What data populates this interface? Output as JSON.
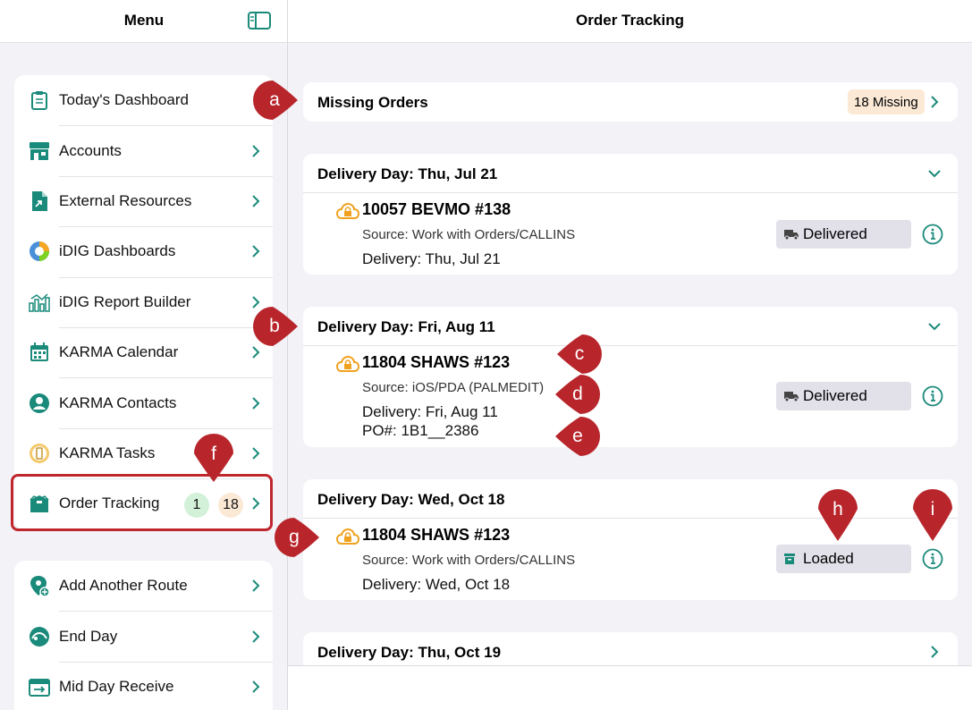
{
  "sidebar": {
    "title": "Menu",
    "groups": [
      [
        {
          "label": "Today's Dashboard",
          "icon": "clipboard-icon"
        },
        {
          "label": "Accounts",
          "icon": "store-icon"
        },
        {
          "label": "External Resources",
          "icon": "external-doc-icon"
        },
        {
          "label": "iDIG Dashboards",
          "icon": "pie-chart-icon"
        },
        {
          "label": "iDIG Report Builder",
          "icon": "bar-chart-icon"
        },
        {
          "label": "KARMA Calendar",
          "icon": "calendar-icon"
        },
        {
          "label": "KARMA Contacts",
          "icon": "person-icon"
        },
        {
          "label": "KARMA Tasks",
          "icon": "tasks-icon"
        },
        {
          "label": "Order Tracking",
          "icon": "box-icon",
          "badges": [
            "1",
            "18"
          ]
        }
      ],
      [
        {
          "label": "Add Another Route",
          "icon": "route-pin-icon"
        },
        {
          "label": "End Day",
          "icon": "end-day-icon"
        },
        {
          "label": "Mid Day Receive",
          "icon": "receive-calendar-icon"
        }
      ]
    ]
  },
  "main": {
    "title": "Order Tracking",
    "missing": {
      "label": "Missing Orders",
      "count": "18 Missing"
    },
    "days": [
      {
        "header": "Delivery Day: Thu, Jul 21",
        "expanded": true,
        "order": {
          "name": "10057 BEVMO #138",
          "source": "Source: Work with Orders/CALLINS",
          "delivery": "Delivery: Thu, Jul 21",
          "po": "",
          "status": "Delivered"
        }
      },
      {
        "header": "Delivery Day: Fri, Aug 11",
        "expanded": true,
        "order": {
          "name": "11804 SHAWS #123",
          "source": "Source: iOS/PDA (PALMEDIT)",
          "delivery": "Delivery: Fri, Aug 11",
          "po": "PO#: 1B1__2386",
          "status": "Delivered"
        }
      },
      {
        "header": "Delivery Day: Wed, Oct 18",
        "expanded": true,
        "order": {
          "name": "11804 SHAWS #123",
          "source": "Source: Work with Orders/CALLINS",
          "delivery": "Delivery: Wed, Oct 18",
          "po": "",
          "status": "Loaded"
        }
      },
      {
        "header": "Delivery Day: Thu, Oct 19",
        "expanded": false
      }
    ]
  },
  "callouts": [
    "a",
    "b",
    "c",
    "d",
    "e",
    "f",
    "g",
    "h",
    "i"
  ],
  "colors": {
    "accent": "#1a8a7a",
    "callout": "#b8262c",
    "lock": "#f0a21f"
  }
}
